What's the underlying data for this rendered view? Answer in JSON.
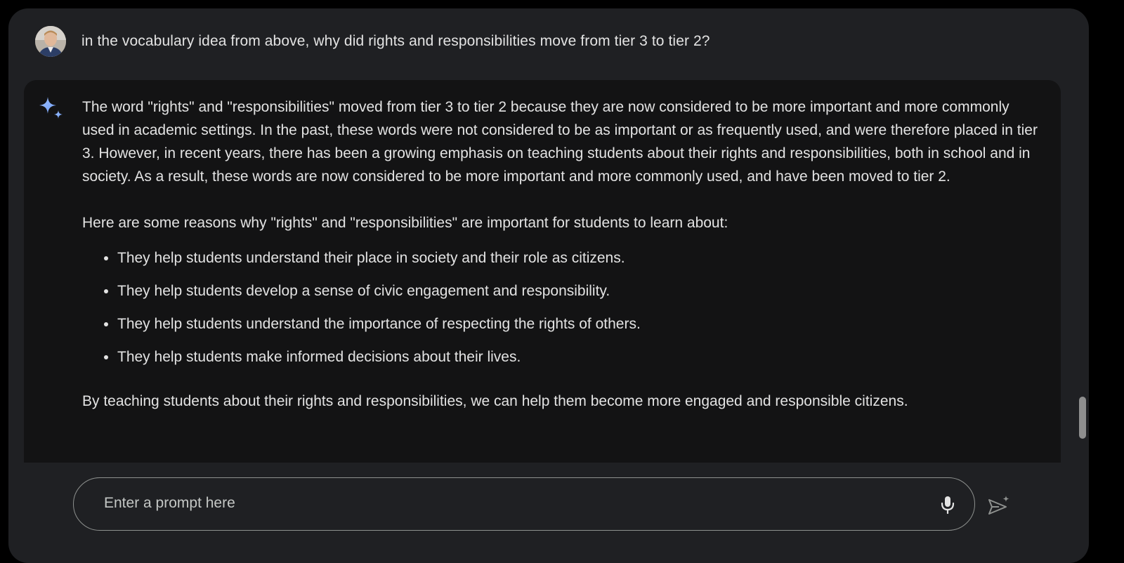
{
  "user_message": {
    "avatar_icon": "user-avatar-photo",
    "text": "in the vocabulary idea from above, why did rights and responsibilities move from tier 3 to tier 2?"
  },
  "response": {
    "icon": "gemini-sparkle-icon",
    "paragraph_1": "The word \"rights\" and \"responsibilities\" moved from tier 3 to tier 2 because they are now considered to be more important and more commonly used in academic settings. In the past, these words were not considered to be as important or as frequently used, and were therefore placed in tier 3. However, in recent years, there has been a growing emphasis on teaching students about their rights and responsibilities, both in school and in society. As a result, these words are now considered to be more important and more commonly used, and have been moved to tier 2.",
    "paragraph_2": "Here are some reasons why \"rights\" and \"responsibilities\" are important for students to learn about:",
    "bullets": [
      "They help students understand their place in society and their role as citizens.",
      "They help students develop a sense of civic engagement and responsibility.",
      "They help students understand the importance of respecting the rights of others.",
      "They help students make informed decisions about their lives."
    ],
    "paragraph_3": "By teaching students about their rights and responsibilities, we can help them become more engaged and responsible citizens."
  },
  "input": {
    "placeholder": "Enter a prompt here",
    "value": "",
    "mic_icon": "microphone-icon",
    "send_icon": "send-sparkle-icon"
  },
  "colors": {
    "window_bg": "#1f2023",
    "card_bg": "#131314",
    "text": "#e3e3e3",
    "accent_blue": "#8ab4f8"
  }
}
